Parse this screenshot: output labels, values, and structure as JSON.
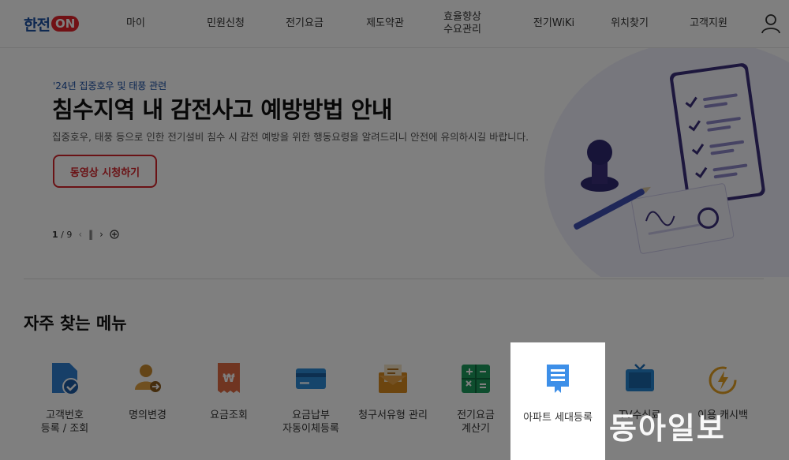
{
  "header": {
    "logo_text": "한전",
    "logo_on": "ON",
    "nav": [
      {
        "label": "마이"
      },
      {
        "label": "민원신청"
      },
      {
        "label": "전기요금"
      },
      {
        "label": "제도약관"
      },
      {
        "label": "효율향상\n수요관리"
      },
      {
        "label": "전기WiKi"
      },
      {
        "label": "위치찾기"
      },
      {
        "label": "고객지원"
      }
    ]
  },
  "hero": {
    "subtitle": "'24년 집중호우 및 태풍 관련",
    "title": "침수지역 내 감전사고 예방방법 안내",
    "description": "집중호우, 태풍 등으로 인한 전기설비 침수 시 감전 예방을 위한 행동요령을 알려드리니 안전에 유의하시길 바랍니다.",
    "button_label": "동영상 시청하기",
    "pager_current": "1",
    "pager_total": "/ 9"
  },
  "frequent": {
    "title": "자주 찾는 메뉴",
    "items": [
      {
        "label": "고객번호\n등록 / 조회",
        "icon": "document-check-icon"
      },
      {
        "label": "명의변경",
        "icon": "user-change-icon"
      },
      {
        "label": "요금조회",
        "icon": "bill-icon"
      },
      {
        "label": "요금납부\n자동이체등록",
        "icon": "card-icon"
      },
      {
        "label": "청구서유형 관리",
        "icon": "envelope-icon"
      },
      {
        "label": "전기요금\n계산기",
        "icon": "calculator-icon"
      },
      {
        "label": "아파트 세대등록",
        "icon": "apartment-icon"
      },
      {
        "label": "TV수신료",
        "icon": "tv-icon"
      },
      {
        "label": "이용 캐시백",
        "icon": "cashback-icon"
      }
    ]
  },
  "watermark": "동아일보",
  "colors": {
    "brand_blue": "#1a4fa0",
    "brand_red": "#e2232b",
    "button_red": "#d4242b"
  }
}
